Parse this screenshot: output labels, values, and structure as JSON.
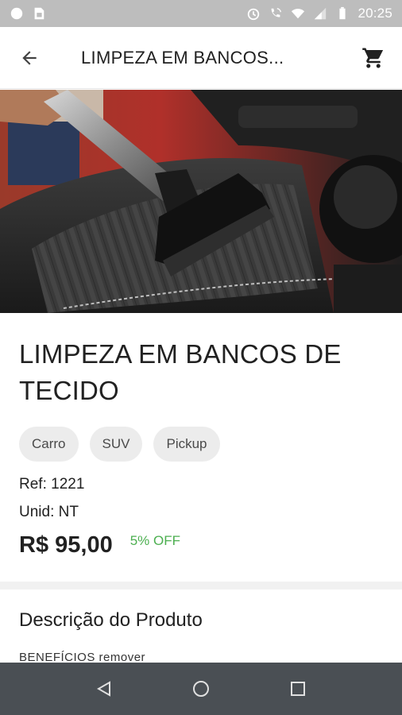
{
  "status_bar": {
    "time": "20:25",
    "icons": [
      "circle-icon",
      "sim-icon",
      "alarm-icon",
      "wifi-call-icon",
      "wifi-icon",
      "signal-icon",
      "battery-icon"
    ]
  },
  "app_bar": {
    "title": "LIMPEZA EM BANCOS...",
    "back_icon": "arrow-left-icon",
    "cart_icon": "shopping-cart-icon"
  },
  "hero": {
    "image": "car-seat-vacuum-cleaning-photo"
  },
  "product": {
    "title": "LIMPEZA EM BANCOS DE TECIDO",
    "chips": [
      "Carro",
      "SUV",
      "Pickup"
    ],
    "ref": "Ref: 1221",
    "unit": "Unid: NT",
    "price": "R$ 95,00",
    "discount": "5% OFF"
  },
  "description": {
    "title": "Descrição do Produto",
    "preview": "BENEFÍCIOS remover"
  },
  "nav_bar": {
    "icons": [
      "back-triangle-icon",
      "home-circle-icon",
      "recents-square-icon"
    ]
  },
  "colors": {
    "status_bar": "#bdbdbd",
    "discount": "#4caf50",
    "nav_bar": "#4a4f54",
    "chip_bg": "#ececec"
  }
}
